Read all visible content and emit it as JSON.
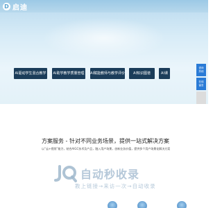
{
  "header": {
    "logo_mark": "D",
    "logo_text": "启迪"
  },
  "hero": {
    "buttons": [
      "AI驱动学生混合教学",
      "AI助学教学质量管理",
      "AI赋能教师与教学评价",
      "AI知识图谱",
      "AI课"
    ]
  },
  "float_bar": {
    "items": [
      {
        "label": "咨询\n热线"
      },
      {
        "label": "在线\n留言"
      }
    ]
  },
  "section": {
    "title": "方案服务 - 针对不同业务场景，提供一站式解决方案",
    "subtitle": "以“云+视频”能力，结合AIGC技术及产品，融入用户场景，创新业务价值，提供多个用户场景化解决方案"
  },
  "watermark": {
    "logo_text": "JQ",
    "title": "自动秒收录",
    "subtitle": "教上链接→来访一次→自动收录"
  },
  "colors": {
    "hero_button": "#1b3d5a",
    "float_accent": "#2a7bd6",
    "float_gray": "#dcdcdc"
  }
}
